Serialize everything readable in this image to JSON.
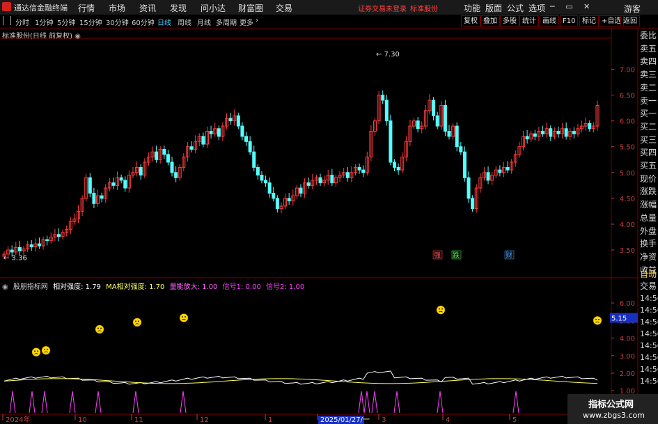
{
  "app": {
    "title": "通达信金融终端",
    "status_warning": "证券交易未登录",
    "stock_name": "标准股份"
  },
  "menu": [
    "行情",
    "市场",
    "资讯",
    "发现",
    "问小达",
    "财富圈",
    "交易"
  ],
  "toolbar_right": [
    "功能",
    "版面",
    "公式",
    "选项"
  ],
  "guest": "游客",
  "periods": [
    "分时",
    "1分钟",
    "5分钟",
    "15分钟",
    "30分钟",
    "60分钟",
    "日线",
    "周线",
    "月线",
    "多周期",
    "更多"
  ],
  "active_period": "日线",
  "tools": [
    "复权",
    "叠加",
    "多股",
    "统计",
    "画线",
    "F10",
    "标记",
    "+自选",
    "返回"
  ],
  "right_panel": [
    "委比",
    "卖五",
    "卖四",
    "卖三",
    "卖二",
    "卖一",
    "买一",
    "买二",
    "买三",
    "买四",
    "买五",
    "现价",
    "涨跌",
    "涨幅",
    "总量",
    "外盘",
    "换手",
    "净资",
    "收益"
  ],
  "bottom_right": [
    "自动",
    "交易"
  ],
  "chart_label": "标准股份(日线 前复权)",
  "indicator": {
    "name": "股朋指标网",
    "values": [
      {
        "label": "相对强度: 1.79",
        "color": "#ffffff"
      },
      {
        "label": "MA相对强度: 1.70",
        "color": "#ffff60"
      },
      {
        "label": "量能放大: 1.00",
        "color": "#ff60ff"
      },
      {
        "label": "信号1: 0.00",
        "color": "#ff40ff"
      },
      {
        "label": "信号2: 1.00",
        "color": "#ff40ff"
      }
    ]
  },
  "watermark": {
    "name": "指标公式网",
    "url": "www.zbgs3.com"
  },
  "chart_data": {
    "type": "candlestick",
    "price_ticks": [
      "7.00",
      "6.50",
      "6.00",
      "5.50",
      "5.00",
      "4.50",
      "4.00",
      "3.50"
    ],
    "price_ticks_values": [
      7.0,
      6.5,
      6.0,
      5.5,
      5.0,
      4.5,
      4.0,
      3.5
    ],
    "ylim": [
      3.15,
      7.6
    ],
    "max_label": "7.30",
    "min_label": "3.36",
    "x_labels": [
      "2024年",
      "10",
      "11",
      "12",
      "1",
      "2025/01/27/一",
      "3",
      "4",
      "5"
    ],
    "markers": [
      {
        "label": "强",
        "color": "#ff4040"
      },
      {
        "label": "跌",
        "color": "#40ff40"
      },
      {
        "label": "财",
        "color": "#40a0ff"
      }
    ],
    "close": [
      3.42,
      3.5,
      3.46,
      3.55,
      3.48,
      3.52,
      3.6,
      3.56,
      3.62,
      3.58,
      3.7,
      3.68,
      3.75,
      3.8,
      3.76,
      3.84,
      3.9,
      4.05,
      4.1,
      4.25,
      4.5,
      4.9,
      4.6,
      4.4,
      4.55,
      4.5,
      4.7,
      4.8,
      4.75,
      4.9,
      4.85,
      4.7,
      4.95,
      5.0,
      5.1,
      4.95,
      5.2,
      5.3,
      5.4,
      5.25,
      5.45,
      5.35,
      5.2,
      5.0,
      4.9,
      5.1,
      5.3,
      5.5,
      5.45,
      5.6,
      5.7,
      5.55,
      5.8,
      5.75,
      5.85,
      5.7,
      5.9,
      6.05,
      6.0,
      6.1,
      5.9,
      5.7,
      5.6,
      5.4,
      5.1,
      4.95,
      4.85,
      4.8,
      4.6,
      4.5,
      4.3,
      4.35,
      4.5,
      4.45,
      4.55,
      4.7,
      4.6,
      4.8,
      4.75,
      4.85,
      4.9,
      4.8,
      4.85,
      4.95,
      4.8,
      4.9,
      4.95,
      5.0,
      4.9,
      5.0,
      5.1,
      5.05,
      5.0,
      5.3,
      5.8,
      6.0,
      6.5,
      6.4,
      6.0,
      5.2,
      5.1,
      5.05,
      5.3,
      5.6,
      5.9,
      6.0,
      5.85,
      5.9,
      6.2,
      6.4,
      6.1,
      5.9,
      6.3,
      5.8,
      5.7,
      5.9,
      5.5,
      5.4,
      4.9,
      4.5,
      4.3,
      4.7,
      4.9,
      5.0,
      4.85,
      4.95,
      5.05,
      5.0,
      5.1,
      5.05,
      5.2,
      5.35,
      5.5,
      5.7,
      5.65,
      5.75,
      5.7,
      5.8,
      5.75,
      5.85,
      5.7,
      5.8,
      5.75,
      5.85,
      5.7,
      5.8,
      5.75,
      5.85,
      5.9,
      5.95,
      5.85,
      5.9,
      6.3
    ],
    "indicator_ticks": [
      "6.00",
      "5.00",
      "4.00",
      "3.00",
      "2.00",
      "1.00"
    ],
    "indicator_ticks_values": [
      6,
      5,
      4,
      3,
      2,
      1
    ],
    "indicator_ylim": [
      0.85,
      6.6
    ],
    "indicator_current": "5.15",
    "faces": [
      {
        "x": 52,
        "v": 3.2
      },
      {
        "x": 66,
        "v": 3.3
      },
      {
        "x": 143,
        "v": 4.5
      },
      {
        "x": 197,
        "v": 4.9
      },
      {
        "x": 264,
        "v": 5.15
      },
      {
        "x": 633,
        "v": 5.6
      },
      {
        "x": 858,
        "v": 5.0
      }
    ],
    "spikes": [
      18,
      46,
      64,
      104,
      141,
      195,
      263,
      519,
      527,
      538,
      570,
      632,
      741
    ]
  },
  "colors": {
    "up": "#ff3c3c",
    "down": "#54ffff",
    "grid": "#7a0000",
    "axis_text": "#c84040",
    "face": "#ffd700",
    "spike": "#ff40ff",
    "line_white": "#ffffff",
    "line_yellow": "#ffff60"
  }
}
